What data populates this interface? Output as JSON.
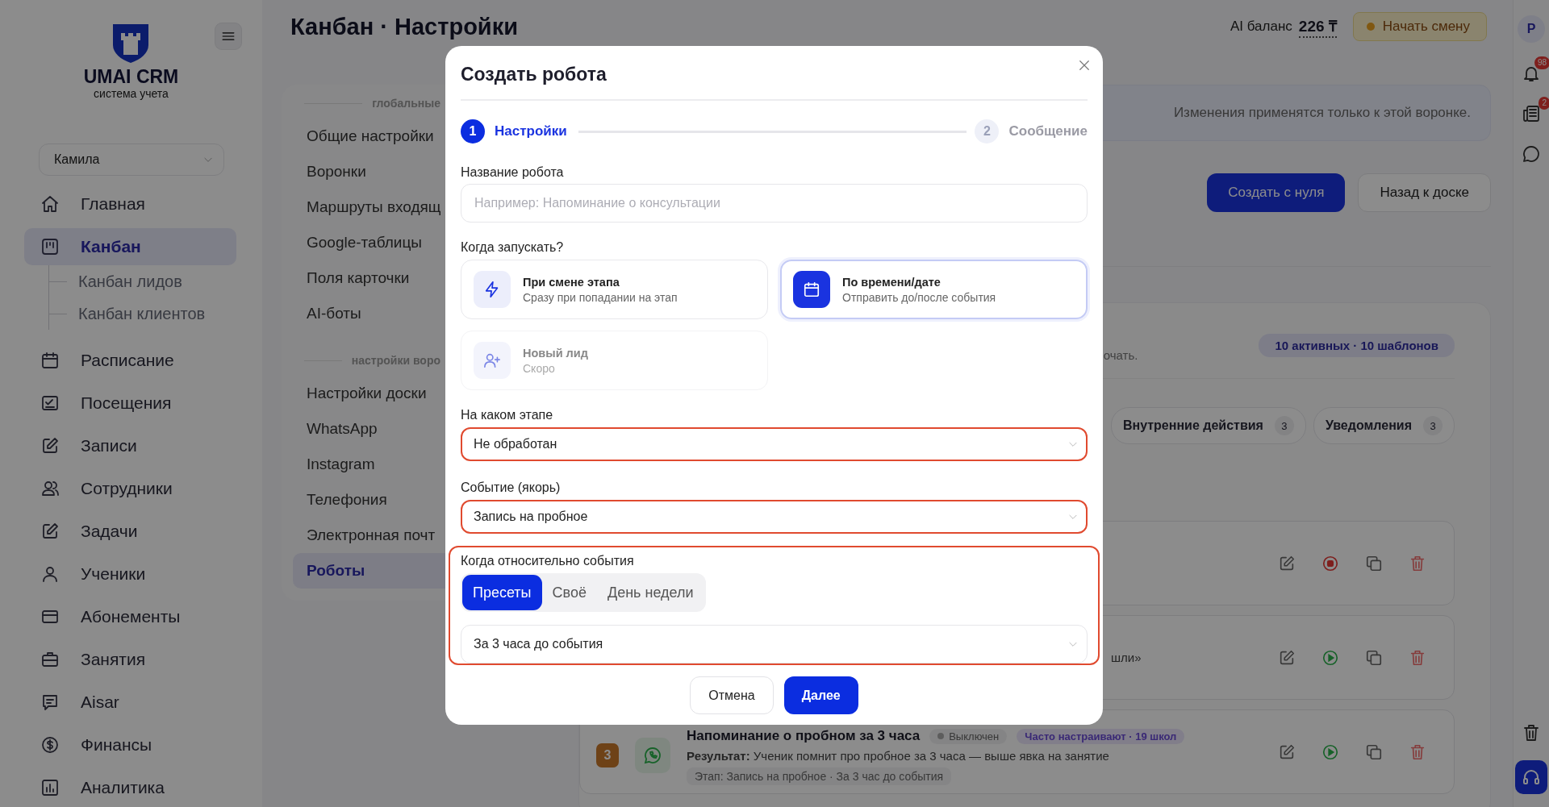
{
  "sidebar": {
    "logo": {
      "title": "UMAI CRM",
      "subtitle": "система учета"
    },
    "account_select": {
      "value": "Камила"
    },
    "items": [
      {
        "label": "Главная",
        "selected": false
      },
      {
        "label": "Канбан",
        "selected": true,
        "expanded": true,
        "children": [
          {
            "label": "Канбан лидов"
          },
          {
            "label": "Канбан клиентов"
          }
        ]
      },
      {
        "label": "Расписание",
        "selected": false
      },
      {
        "label": "Посещения",
        "selected": false
      },
      {
        "label": "Записи",
        "selected": false
      },
      {
        "label": "Сотрудники",
        "selected": false
      },
      {
        "label": "Задачи",
        "selected": false
      },
      {
        "label": "Ученики",
        "selected": false
      },
      {
        "label": "Абонементы",
        "selected": false
      },
      {
        "label": "Занятия",
        "selected": false
      },
      {
        "label": "Aisar",
        "selected": false
      },
      {
        "label": "Финансы",
        "selected": false
      },
      {
        "label": "Аналитика",
        "selected": false
      }
    ]
  },
  "header": {
    "title": "Канбан · Настройки",
    "ai_balance_label": "AI баланс",
    "ai_balance_value": "226 ₸",
    "start_shift_button": "Начать смену"
  },
  "right_rail": {
    "avatar": "P",
    "notifications_badge": "98",
    "news_badge": "2"
  },
  "settings_nav": {
    "groups": [
      {
        "title": "глобальные",
        "items": [
          {
            "label": "Общие настройки",
            "selected": false
          },
          {
            "label": "Воронки",
            "selected": false
          },
          {
            "label": "Маршруты входящ",
            "selected": false
          },
          {
            "label": "Google-таблицы",
            "selected": false
          },
          {
            "label": "Поля карточки",
            "selected": false
          },
          {
            "label": "AI-боты",
            "selected": false
          }
        ]
      },
      {
        "title": "настройки воро",
        "items": [
          {
            "label": "Настройки доски",
            "selected": false
          },
          {
            "label": "WhatsApp",
            "selected": false
          },
          {
            "label": "Instagram",
            "selected": false
          },
          {
            "label": "Телефония",
            "selected": false
          },
          {
            "label": "Электронная почт",
            "selected": false
          },
          {
            "label": "Роботы",
            "selected": true
          }
        ]
      }
    ]
  },
  "content": {
    "notice": "Изменения применятся только к этой воронке.",
    "buttons": [
      {
        "label": "Создать с нуля",
        "kind": "primary"
      },
      {
        "label": "Назад к доске",
        "kind": "secondary"
      }
    ],
    "robots_card": {
      "description": "очать.",
      "summary_badge": "10 активных · 10 шаблонов",
      "filters": [
        {
          "label": "Внутренние действия",
          "count": "3"
        },
        {
          "label": "Уведомления",
          "count": "3"
        }
      ],
      "robots": [
        {
          "running": true
        },
        {
          "result": "шли»",
          "running": false
        },
        {
          "number": "3",
          "title": "Напоминание о пробном за 3 часа",
          "status": "Выключен",
          "popularity": "Часто настраивают · 19 школ",
          "result": "**Результат:** Ученик помнит про пробное за 3 часа — выше явка на занятие",
          "stage": "Этап: Запись на пробное · За 3 час до события",
          "running": false
        }
      ]
    }
  },
  "modal": {
    "title": "Создать робота",
    "steps": [
      {
        "number": "1",
        "label": "Настройки",
        "active": true
      },
      {
        "number": "2",
        "label": "Сообщение",
        "active": false
      }
    ],
    "name_field": {
      "label": "Название робота",
      "placeholder": "Например: Напоминание о консультации"
    },
    "trigger": {
      "label": "Когда запускать?",
      "options": [
        {
          "title": "При смене этапа",
          "subtitle": "Сразу при попадании на этап",
          "selected": false,
          "disabled": false
        },
        {
          "title": "По времени/дате",
          "subtitle": "Отправить до/после события",
          "selected": true,
          "disabled": false
        },
        {
          "title": "Новый лид",
          "subtitle": "Скоро",
          "selected": false,
          "disabled": true
        }
      ]
    },
    "stage_field": {
      "label": "На каком этапе",
      "value": "Не обработан",
      "highlighted": true
    },
    "event_field": {
      "label": "Событие (якорь)",
      "value": "Запись на пробное",
      "highlighted": true
    },
    "timing": {
      "label": "Когда относительно события",
      "highlighted": true,
      "modes": [
        {
          "label": "Пресеты",
          "selected": true
        },
        {
          "label": "Своё",
          "selected": false
        },
        {
          "label": "День недели",
          "selected": false
        }
      ],
      "preset_select": {
        "value": "За 3 часа до события"
      }
    },
    "buttons": [
      {
        "label": "Отмена",
        "kind": "secondary"
      },
      {
        "label": "Далее",
        "kind": "primary"
      }
    ]
  }
}
